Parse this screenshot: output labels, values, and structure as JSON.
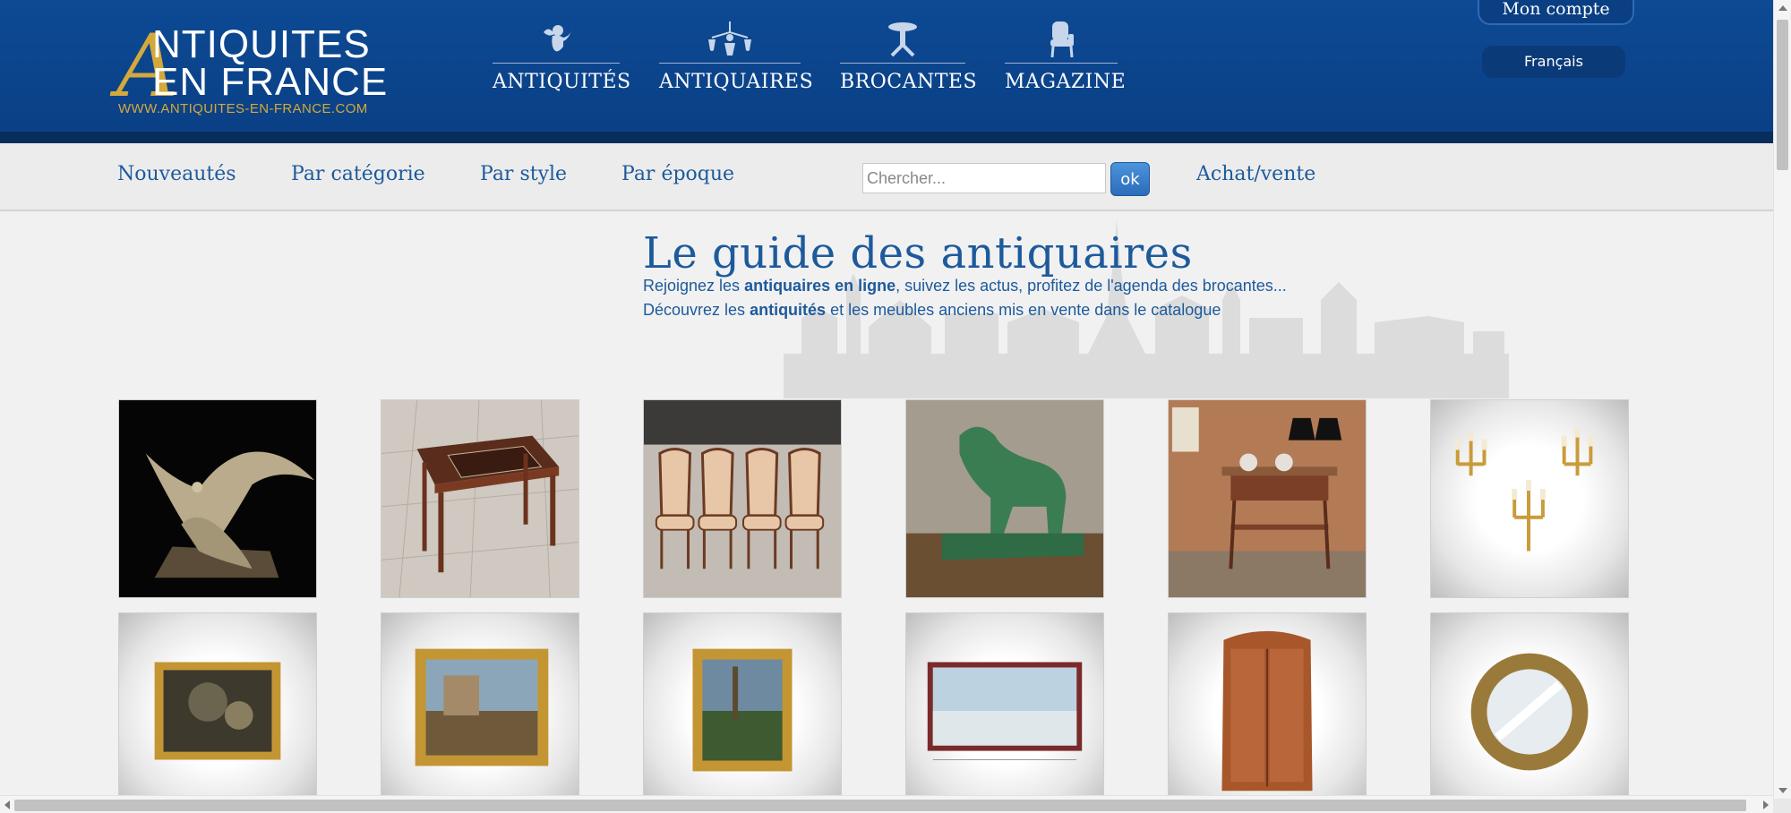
{
  "logo": {
    "line1": "NTIQUITES",
    "line2": "EN FRANCE",
    "big_letter": "A",
    "url": "WWW.ANTIQUITES-EN-FRANCE.COM"
  },
  "topnav": [
    {
      "label": "ANTIQUITÉS",
      "icon": "cherub-icon"
    },
    {
      "label": "ANTIQUAIRES",
      "icon": "chandelier-icon"
    },
    {
      "label": "BROCANTES",
      "icon": "pedestal-table-icon"
    },
    {
      "label": "MAGAZINE",
      "icon": "armchair-icon"
    }
  ],
  "account": {
    "label": "Mon compte",
    "language": "Français"
  },
  "subnav": {
    "links": [
      "Nouveautés",
      "Par catégorie",
      "Par style",
      "Par époque",
      "Achat/vente"
    ],
    "search_placeholder": "Chercher...",
    "search_button": "ok"
  },
  "hero": {
    "title": "Le guide des antiquaires",
    "line1_pre": "Rejoignez les ",
    "line1_bold": "antiquaires en ligne",
    "line1_post": ", suivez les actus, profitez de l'agenda des brocantes...",
    "line2_pre": "Découvrez les ",
    "line2_bold": "antiquités",
    "line2_post": " et les meubles anciens mis en vente dans le catalogue"
  },
  "catalog": [
    {
      "subject": "pheasant-bronze-sculpture"
    },
    {
      "subject": "marquetry-side-table"
    },
    {
      "subject": "set-of-four-chairs"
    },
    {
      "subject": "green-dog-sculpture"
    },
    {
      "subject": "marble-console-with-lamps"
    },
    {
      "subject": "gilt-wall-sconces"
    },
    {
      "subject": "framed-painting-dark"
    },
    {
      "subject": "framed-landscape-painting"
    },
    {
      "subject": "framed-forest-painting"
    },
    {
      "subject": "framed-seascape-painting"
    },
    {
      "subject": "walnut-armoire"
    },
    {
      "subject": "porthole-mirror"
    }
  ],
  "colors": {
    "header": "#0d4a94",
    "brand_blue": "#1d5a9c",
    "gold": "#d4a93c"
  }
}
